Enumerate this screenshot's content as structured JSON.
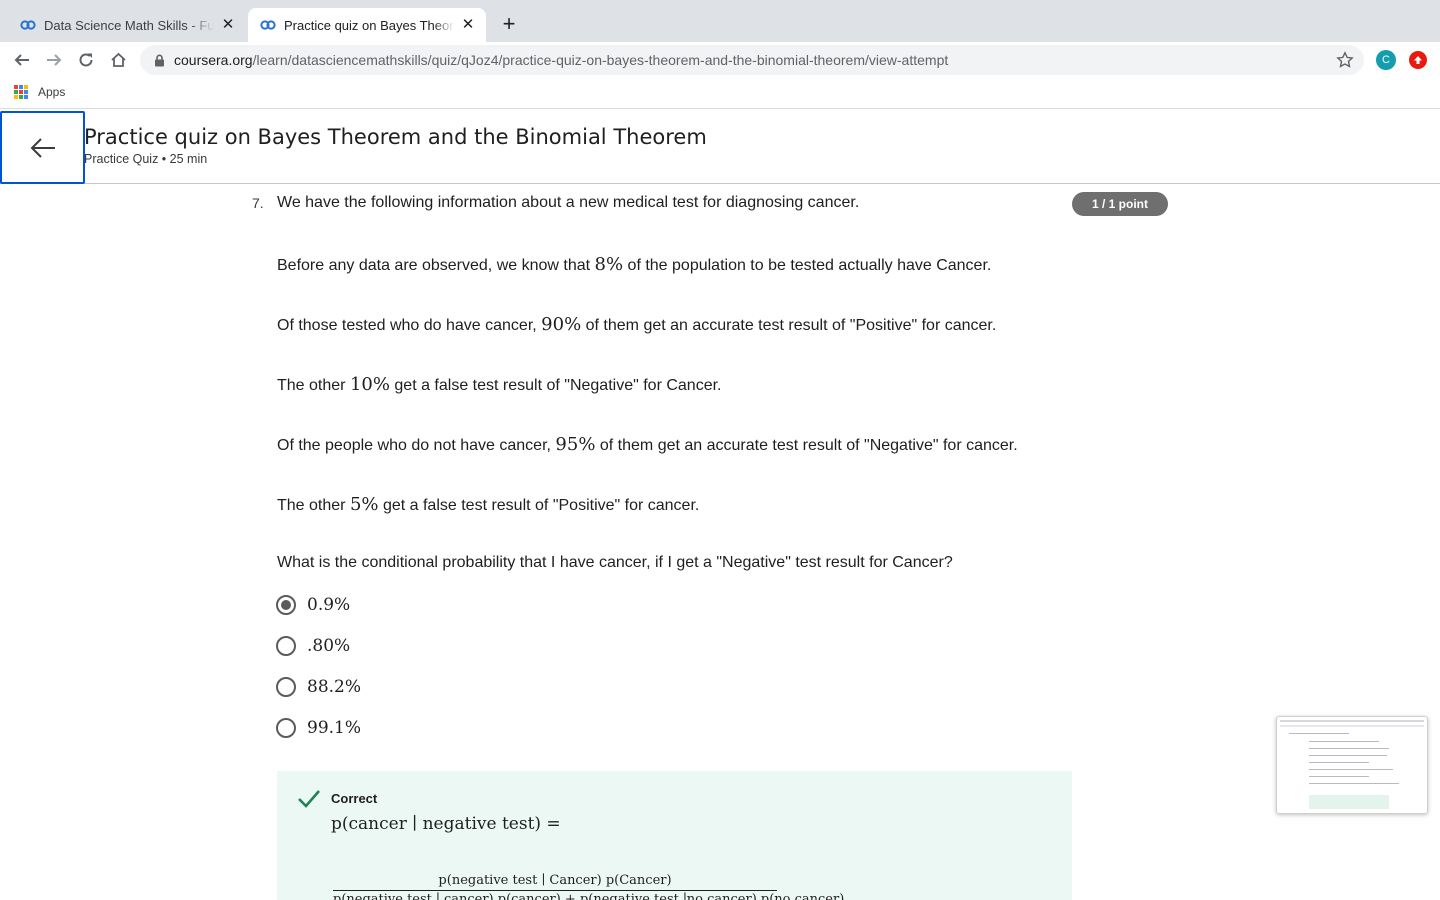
{
  "browser": {
    "tabs": [
      {
        "title": "Data Science Math Skills - Fun",
        "active": false
      },
      {
        "title": "Practice quiz on Bayes Theorem",
        "active": true
      }
    ],
    "url_host": "coursera.org",
    "url_path": "/learn/datasciencemathskills/quiz/qJoz4/practice-quiz-on-bayes-theorem-and-the-binomial-theorem/view-attempt",
    "profile_initial": "C",
    "bookmarks": {
      "apps_label": "Apps"
    },
    "colors": {
      "tabstrip": "#dee1e6",
      "profile": "#129eaf",
      "extension": "#e8190f"
    }
  },
  "header": {
    "title": "Practice quiz on Bayes Theorem and the Binomial Theorem",
    "subtitle": "Practice Quiz • 25 min",
    "accent": "#0056d2"
  },
  "question": {
    "number": "7.",
    "points": "1 / 1 point",
    "p1": "We have the following information about a new medical test for diagnosing cancer.",
    "p2_before": "Before any data are observed, we know that ",
    "p2_math": "8%",
    "p2_after": " of the population to be tested actually have Cancer.",
    "p3_before": "Of those tested who do have cancer, ",
    "p3_math": "90%",
    "p3_after": " of them get an accurate test result of \"Positive\" for cancer.",
    "p4_before": "The other ",
    "p4_math": "10%",
    "p4_after": " get a false test result of \"Negative\" for Cancer.",
    "p5_before": "Of the people who do not have cancer, ",
    "p5_math": "95%",
    "p5_after": " of them get an accurate test result of \"Negative\" for cancer.",
    "p6_before": "The other ",
    "p6_math": "5%",
    "p6_after": " get a false test result of \"Positive\" for cancer.",
    "prompt": "What is the conditional probability that I have cancer, if I get a \"Negative\" test result for Cancer?",
    "options": [
      {
        "label": "0.9%",
        "selected": true
      },
      {
        "label": ".80%",
        "selected": false
      },
      {
        "label": "88.2%",
        "selected": false
      },
      {
        "label": "99.1%",
        "selected": false
      }
    ]
  },
  "feedback": {
    "status": "Correct",
    "formula_line": "p(cancer ∣ negative test) =",
    "numerator": "p(negative test ∣ Cancer) p(Cancer)",
    "denominator": "p(negative test ∣ cancer) p(cancer) + p(negative test ∣no cancer) p(no cancer)",
    "background": "#ecf8f3",
    "check_color": "#1f8354"
  }
}
